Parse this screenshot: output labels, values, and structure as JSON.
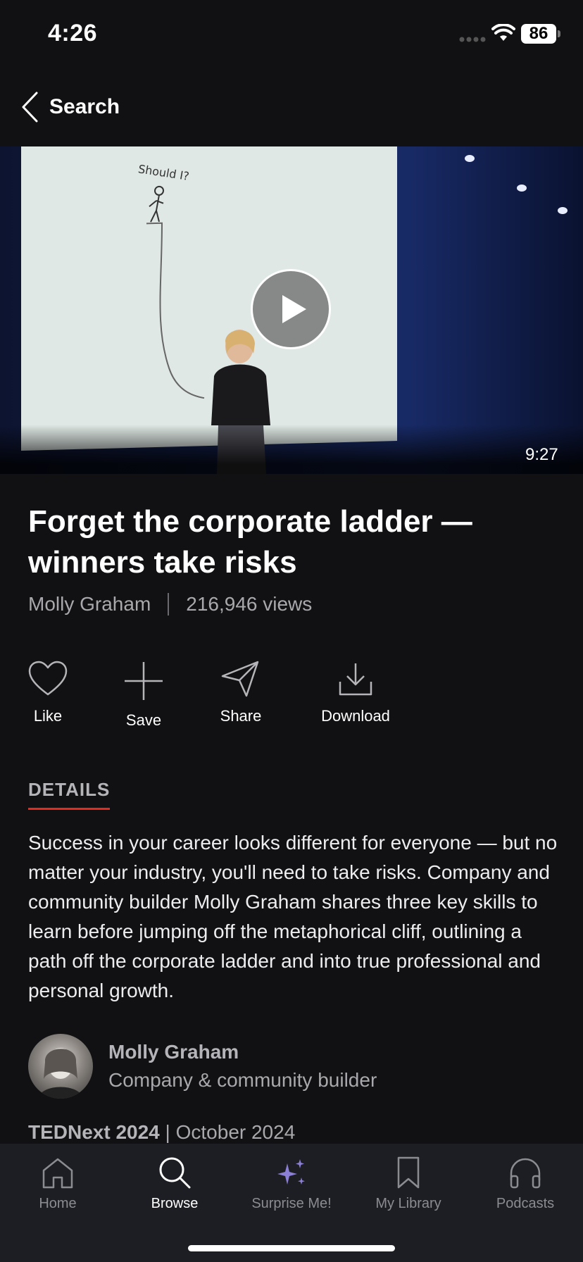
{
  "status_bar": {
    "time": "4:26",
    "battery": "86"
  },
  "nav": {
    "back_label": "Search"
  },
  "video": {
    "duration": "9:27",
    "slide_text": "Should I?"
  },
  "talk": {
    "title": "Forget the corporate ladder — winners take risks",
    "speaker": "Molly Graham",
    "views": "216,946 views"
  },
  "actions": [
    {
      "label": "Like",
      "icon": "heart-icon"
    },
    {
      "label": "Save",
      "icon": "plus-icon"
    },
    {
      "label": "Share",
      "icon": "paper-plane-icon"
    },
    {
      "label": "Download",
      "icon": "download-icon"
    }
  ],
  "details": {
    "tab_label": "DETAILS",
    "description": "Success in your career looks different for everyone — but no matter your industry, you'll need to take risks. Company and community builder Molly Graham shares three key skills to learn before jumping off the metaphorical cliff, outlining a path off the corporate ladder and into true professional and personal growth."
  },
  "speaker_card": {
    "name": "Molly Graham",
    "role": "Company & community builder"
  },
  "event": {
    "name": "TEDNext 2024",
    "separator": " | ",
    "date": "October 2024"
  },
  "tabbar": [
    {
      "label": "Home",
      "icon": "home-icon",
      "active": false
    },
    {
      "label": "Browse",
      "icon": "search-icon",
      "active": true
    },
    {
      "label": "Surprise Me!",
      "icon": "sparkles-icon",
      "active": false
    },
    {
      "label": "My Library",
      "icon": "bookmark-icon",
      "active": false
    },
    {
      "label": "Podcasts",
      "icon": "headphones-icon",
      "active": false
    }
  ],
  "colors": {
    "background": "#111113",
    "accent_red": "#e62b1e",
    "sparkle_purple": "#8b7fd6",
    "tabbar": "#1d1e23"
  }
}
